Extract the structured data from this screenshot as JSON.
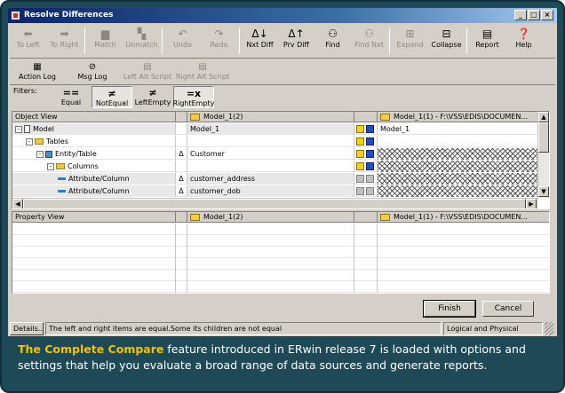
{
  "window": {
    "title": "Resolve Differences",
    "controls": [
      "_",
      "□",
      "×"
    ]
  },
  "toolbar": {
    "buttons": [
      {
        "label": "To Left",
        "icon": "arrow-left-icon",
        "glyph": "⬅",
        "enabled": false
      },
      {
        "label": "To Right",
        "icon": "arrow-right-icon",
        "glyph": "➡",
        "enabled": false
      },
      {
        "label": "Match",
        "icon": "match-icon",
        "glyph": "▆",
        "enabled": false
      },
      {
        "label": "Unmatch",
        "icon": "unmatch-icon",
        "glyph": "▚",
        "enabled": false
      },
      {
        "label": "Undo",
        "icon": "undo-icon",
        "glyph": "↶",
        "enabled": false
      },
      {
        "label": "Redo",
        "icon": "redo-icon",
        "glyph": "↷",
        "enabled": false
      },
      {
        "label": "Nxt Diff",
        "icon": "next-diff-icon",
        "glyph": "Δ↓",
        "enabled": true
      },
      {
        "label": "Prv Diff",
        "icon": "prev-diff-icon",
        "glyph": "Δ↑",
        "enabled": true
      },
      {
        "label": "Find",
        "icon": "binoculars-icon",
        "glyph": "⚇",
        "enabled": true
      },
      {
        "label": "Find Nxt",
        "icon": "find-next-icon",
        "glyph": "⚇",
        "enabled": false
      },
      {
        "label": "Expand",
        "icon": "expand-icon",
        "glyph": "⊞",
        "enabled": false
      },
      {
        "label": "Collapse",
        "icon": "collapse-icon",
        "glyph": "⊟",
        "enabled": true
      },
      {
        "label": "Report",
        "icon": "report-icon",
        "glyph": "▤",
        "enabled": true
      },
      {
        "label": "Help",
        "icon": "help-icon",
        "glyph": "❓",
        "enabled": true
      }
    ]
  },
  "toolbar2": {
    "buttons": [
      {
        "label": "Action Log",
        "icon": "action-log-icon",
        "glyph": "▦",
        "enabled": true
      },
      {
        "label": "Msg Log",
        "icon": "msg-log-icon",
        "glyph": "⊘",
        "enabled": true
      },
      {
        "label": "Left Alt Script",
        "icon": "left-script-icon",
        "glyph": "▤",
        "enabled": false
      },
      {
        "label": "Right Alt Script",
        "icon": "right-script-icon",
        "glyph": "▤",
        "enabled": false
      }
    ]
  },
  "filters": {
    "label": "Filters:",
    "buttons": [
      {
        "label": "Equal",
        "icon": "equal-icon",
        "glyph": "==",
        "active": false
      },
      {
        "label": "NotEqual",
        "icon": "not-equal-icon",
        "glyph": "≠",
        "active": true
      },
      {
        "label": "LeftEmpty",
        "icon": "left-empty-icon",
        "glyph": "≠",
        "active": false
      },
      {
        "label": "RightEmpty",
        "icon": "right-empty-icon",
        "glyph": "=x",
        "active": true
      }
    ]
  },
  "object_view": {
    "headers": {
      "object": "Object View",
      "left_model": "Model_1(2)",
      "right_model": "Model_1(1) - F:\\VSS\\EDIS\\DOCUMEN..."
    },
    "rows": [
      {
        "name": "Model",
        "indent": 0,
        "node": "doc",
        "toggle": "-",
        "diff": "",
        "left": "Model_1",
        "right": "Model_1",
        "arrows": "yb",
        "hatch": false,
        "gray": true
      },
      {
        "name": "Tables",
        "indent": 1,
        "node": "folder",
        "toggle": "-",
        "diff": "",
        "left": "",
        "right": "",
        "arrows": "yb",
        "hatch": false,
        "gray": false
      },
      {
        "name": "Entity/Table",
        "indent": 2,
        "node": "entity",
        "toggle": "-",
        "diff": "Δ",
        "left": "Customer",
        "right": "",
        "arrows": "yb",
        "hatch": true,
        "gray": false
      },
      {
        "name": "Columns",
        "indent": 3,
        "node": "folder",
        "toggle": "-",
        "diff": "",
        "left": "",
        "right": "",
        "arrows": "yb",
        "hatch": true,
        "gray": false
      },
      {
        "name": "Attribute/Column",
        "indent": 4,
        "node": "column",
        "toggle": "",
        "diff": "Δ",
        "left": "customer_address",
        "right": "",
        "arrows": "gg",
        "hatch": true,
        "gray": true
      },
      {
        "name": "Attribute/Column",
        "indent": 4,
        "node": "column",
        "toggle": "",
        "diff": "Δ",
        "left": "customer_dob",
        "right": "",
        "arrows": "gg",
        "hatch": true,
        "gray": true
      }
    ]
  },
  "property_view": {
    "headers": {
      "property": "Property View",
      "left_model": "Model_1(2)",
      "right_model": "Model_1(1) - F:\\VSS\\EDIS\\DOCUMEN..."
    }
  },
  "buttons": {
    "finish": "Finish",
    "cancel": "Cancel"
  },
  "status": {
    "details": "Details...",
    "message": "The left and right items are equal.Some its children are not equal",
    "mode": "Logical and Physical"
  },
  "caption": {
    "highlight": "The Complete Compare",
    "text": " feature introduced in ERwin release 7 is loaded with options and settings that help you evaluate a broad range of data sources and generate reports."
  },
  "colors": {
    "frame": "#1e4a58",
    "caption_highlight": "#f2c200",
    "titlebar": "#0a246a"
  }
}
